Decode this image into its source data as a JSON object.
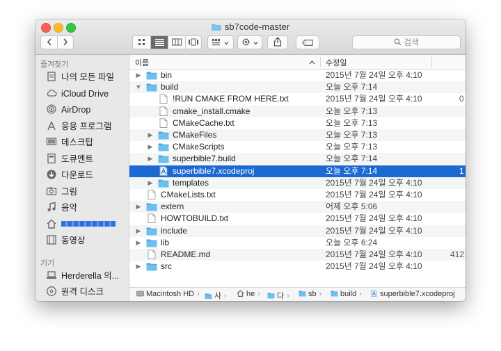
{
  "window": {
    "title": "sb7code-master"
  },
  "toolbar": {
    "back_icon": "chevron-left-icon",
    "forward_icon": "chevron-right-icon",
    "view_modes": [
      "icon-view",
      "list-view",
      "column-view",
      "gallery-view"
    ],
    "arrange_icon": "arrange-grid-icon",
    "action_icon": "gear-icon",
    "share_icon": "share-icon",
    "tag_icon": "tag-icon",
    "search_placeholder": "검색"
  },
  "sidebar": {
    "favorites_header": "즐겨찾기",
    "favorites": [
      {
        "label": "나의 모든 파일",
        "icon": "all-files-icon"
      },
      {
        "label": "iCloud Drive",
        "icon": "cloud-icon"
      },
      {
        "label": "AirDrop",
        "icon": "airdrop-icon"
      },
      {
        "label": "응용 프로그램",
        "icon": "applications-icon"
      },
      {
        "label": "데스크탑",
        "icon": "desktop-icon"
      },
      {
        "label": "도큐멘트",
        "icon": "documents-icon"
      },
      {
        "label": "다운로드",
        "icon": "downloads-icon"
      },
      {
        "label": "그림",
        "icon": "pictures-icon"
      },
      {
        "label": "음악",
        "icon": "music-icon"
      },
      {
        "label": "",
        "icon": "home-icon"
      },
      {
        "label": "동영상",
        "icon": "movies-icon"
      }
    ],
    "devices_header": "기기",
    "devices": [
      {
        "label": "Herderella 의...",
        "icon": "laptop-icon"
      },
      {
        "label": "원격 디스크",
        "icon": "disc-icon"
      }
    ]
  },
  "columns": {
    "name": "이름",
    "date": "수정일"
  },
  "files": [
    {
      "name": "bin",
      "date": "2015년 7월 24일 오후 4:10",
      "size": "",
      "kind": "folder",
      "indent": 0,
      "disclosure": "collapsed"
    },
    {
      "name": "build",
      "date": "오늘 오후 7:14",
      "size": "",
      "kind": "folder",
      "indent": 0,
      "disclosure": "expanded"
    },
    {
      "name": "!RUN CMAKE FROM HERE.txt",
      "date": "2015년 7월 24일 오후 4:10",
      "size": "0",
      "kind": "file",
      "indent": 1,
      "disclosure": "none"
    },
    {
      "name": "cmake_install.cmake",
      "date": "오늘 오후 7:13",
      "size": "",
      "kind": "file",
      "indent": 1,
      "disclosure": "none"
    },
    {
      "name": "CMakeCache.txt",
      "date": "오늘 오후 7:13",
      "size": "",
      "kind": "file",
      "indent": 1,
      "disclosure": "none"
    },
    {
      "name": "CMakeFiles",
      "date": "오늘 오후 7:13",
      "size": "",
      "kind": "folder",
      "indent": 1,
      "disclosure": "collapsed"
    },
    {
      "name": "CMakeScripts",
      "date": "오늘 오후 7:13",
      "size": "",
      "kind": "folder",
      "indent": 1,
      "disclosure": "collapsed"
    },
    {
      "name": "superbible7.build",
      "date": "오늘 오후 7:14",
      "size": "",
      "kind": "folder",
      "indent": 1,
      "disclosure": "collapsed"
    },
    {
      "name": "superbible7.xcodeproj",
      "date": "오늘 오후 7:14",
      "size": "1",
      "kind": "xcodeproj",
      "indent": 1,
      "disclosure": "none",
      "selected": true
    },
    {
      "name": "templates",
      "date": "2015년 7월 24일 오후 4:10",
      "size": "",
      "kind": "folder",
      "indent": 1,
      "disclosure": "collapsed"
    },
    {
      "name": "CMakeLists.txt",
      "date": "2015년 7월 24일 오후 4:10",
      "size": "",
      "kind": "file",
      "indent": 0,
      "disclosure": "none"
    },
    {
      "name": "extern",
      "date": "어제 오후 5:06",
      "size": "",
      "kind": "folder",
      "indent": 0,
      "disclosure": "collapsed"
    },
    {
      "name": "HOWTOBUILD.txt",
      "date": "2015년 7월 24일 오후 4:10",
      "size": "",
      "kind": "file",
      "indent": 0,
      "disclosure": "none"
    },
    {
      "name": "include",
      "date": "2015년 7월 24일 오후 4:10",
      "size": "",
      "kind": "folder",
      "indent": 0,
      "disclosure": "collapsed"
    },
    {
      "name": "lib",
      "date": "오늘 오후 6:24",
      "size": "",
      "kind": "folder",
      "indent": 0,
      "disclosure": "collapsed"
    },
    {
      "name": "README.md",
      "date": "2015년 7월 24일 오후 4:10",
      "size": "412",
      "kind": "file",
      "indent": 0,
      "disclosure": "none"
    },
    {
      "name": "src",
      "date": "2015년 7월 24일 오후 4:10",
      "size": "",
      "kind": "folder",
      "indent": 0,
      "disclosure": "collapsed"
    }
  ],
  "pathbar": [
    {
      "label": "Macintosh HD",
      "icon": "hard-drive-icon"
    },
    {
      "label": "사",
      "icon": "users-folder-icon"
    },
    {
      "label": "he",
      "icon": "home-icon"
    },
    {
      "label": "다",
      "icon": "folder-icon"
    },
    {
      "label": "sb",
      "icon": "folder-icon"
    },
    {
      "label": "build",
      "icon": "folder-icon"
    },
    {
      "label": "superbible7.xcodeproj",
      "icon": "xcodeproj-icon"
    }
  ],
  "colors": {
    "selection": "#1d69d2",
    "folder": "#5fb5ea",
    "accent_blue": "#1d69d2"
  }
}
